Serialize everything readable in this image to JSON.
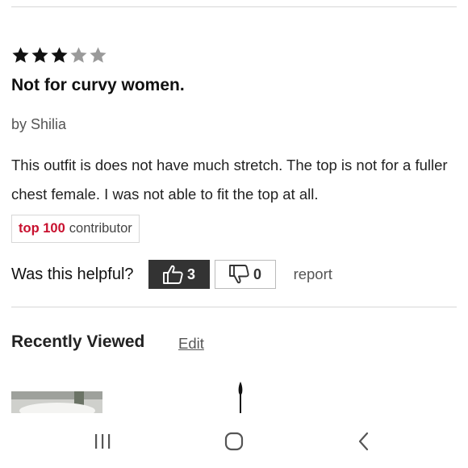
{
  "review": {
    "rating": 3,
    "max_rating": 5,
    "title": "Not for curvy women.",
    "author_line": "by Shilia",
    "body": "This outfit is does not have much stretch. The top is not for a fuller chest female. I was not able to fit the top at all.",
    "badge": {
      "rank": "top 100",
      "label": "contributor"
    }
  },
  "helpful": {
    "prompt": "Was this helpful?",
    "upvotes": "3",
    "downvotes": "0",
    "report_label": "report"
  },
  "recently_viewed": {
    "title": "Recently Viewed",
    "edit_label": "Edit"
  },
  "nav": {
    "icons": [
      "recent-apps-icon",
      "home-icon",
      "back-icon"
    ]
  },
  "colors": {
    "accent_red": "#c8102e",
    "upvote_bg": "#333333"
  }
}
